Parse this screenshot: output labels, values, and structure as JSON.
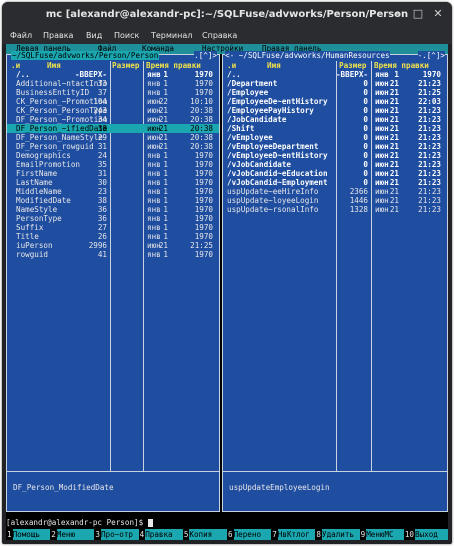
{
  "window": {
    "title": "mc [alexandr@alexandr-pc]:~/SQLFuse/advworks/Person/Person"
  },
  "menubar": [
    "Файл",
    "Правка",
    "Вид",
    "Поиск",
    "Терминал",
    "Справка"
  ],
  "mc_menu": [
    "Левая панель",
    "Файл",
    "Команда",
    "Настройки",
    "Правая панель"
  ],
  "left_panel": {
    "path": "~/SQLFuse/advworks/Person/Person",
    "corner": ".[^]>",
    "headers": {
      "flag": ".и",
      "name": "Имя",
      "size": "Размер",
      "time": "Время правки"
    },
    "rows": [
      {
        "name": "/..",
        "size": "-ВВЕРХ-",
        "mon": "янв",
        "day": "1",
        "time": "1970",
        "type": "dir"
      },
      {
        "name": "Additional~ntactInfo",
        "size": "33",
        "mon": "янв",
        "day": "1",
        "time": "1970",
        "type": "file"
      },
      {
        "name": "BusinessEntityID",
        "size": "37",
        "mon": "янв",
        "day": "1",
        "time": "1970",
        "type": "file"
      },
      {
        "name": "CK_Person_~Promotion",
        "size": "104",
        "mon": "июн",
        "day": "22",
        "time": "10:10",
        "type": "file"
      },
      {
        "name": "CK_Person_PersonType",
        "size": "243",
        "mon": "июн",
        "day": "21",
        "time": "20:38",
        "type": "file"
      },
      {
        "name": "DF_Person_~Promotion",
        "size": "34",
        "mon": "июн",
        "day": "21",
        "time": "20:38",
        "type": "file"
      },
      {
        "name": "DF_Person_~ifiedDate",
        "size": "38",
        "mon": "июн",
        "day": "21",
        "time": "20:38",
        "type": "sel"
      },
      {
        "name": "DF_Person_NameStyle",
        "size": "29",
        "mon": "июн",
        "day": "21",
        "time": "20:38",
        "type": "file"
      },
      {
        "name": "DF_Person_rowguid",
        "size": "31",
        "mon": "июн",
        "day": "21",
        "time": "20:38",
        "type": "file"
      },
      {
        "name": "Demographics",
        "size": "24",
        "mon": "янв",
        "day": "1",
        "time": "1970",
        "type": "file"
      },
      {
        "name": "EmailPromotion",
        "size": "35",
        "mon": "янв",
        "day": "1",
        "time": "1970",
        "type": "file"
      },
      {
        "name": "FirstName",
        "size": "31",
        "mon": "янв",
        "day": "1",
        "time": "1970",
        "type": "file"
      },
      {
        "name": "LastName",
        "size": "30",
        "mon": "янв",
        "day": "1",
        "time": "1970",
        "type": "file"
      },
      {
        "name": "MiddleName",
        "size": "23",
        "mon": "янв",
        "day": "1",
        "time": "1970",
        "type": "file"
      },
      {
        "name": "ModifiedDate",
        "size": "38",
        "mon": "янв",
        "day": "1",
        "time": "1970",
        "type": "file"
      },
      {
        "name": "NameStyle",
        "size": "36",
        "mon": "янв",
        "day": "1",
        "time": "1970",
        "type": "file"
      },
      {
        "name": "PersonType",
        "size": "36",
        "mon": "янв",
        "day": "1",
        "time": "1970",
        "type": "file"
      },
      {
        "name": "Suffix",
        "size": "27",
        "mon": "янв",
        "day": "1",
        "time": "1970",
        "type": "file"
      },
      {
        "name": "Title",
        "size": "26",
        "mon": "янв",
        "day": "1",
        "time": "1970",
        "type": "file"
      },
      {
        "name": "iuPerson",
        "size": "2996",
        "mon": "июн",
        "day": "21",
        "time": "21:25",
        "type": "file"
      },
      {
        "name": "rowguid",
        "size": "41",
        "mon": "янв",
        "day": "1",
        "time": "1970",
        "type": "file"
      }
    ],
    "status": "DF_Person_ModifiedDate"
  },
  "right_panel": {
    "path": "~/SQLFuse/advworks/HumanResources",
    "corner": "-.[^]>",
    "headers": {
      "flag": ".и",
      "name": "Имя",
      "size": "Размер",
      "time": "Время правки"
    },
    "rows": [
      {
        "name": "/..",
        "size": "-ВВЕРХ-",
        "mon": "янв",
        "day": "1",
        "time": "1970",
        "type": "dir"
      },
      {
        "name": "/Department",
        "size": "0",
        "mon": "июн",
        "day": "21",
        "time": "21:23",
        "type": "dir"
      },
      {
        "name": "/Employee",
        "size": "0",
        "mon": "июн",
        "day": "21",
        "time": "21:25",
        "type": "dir"
      },
      {
        "name": "/EmployeeDe~entHistory",
        "size": "0",
        "mon": "июн",
        "day": "21",
        "time": "22:03",
        "type": "dir"
      },
      {
        "name": "/EmployeePayHistory",
        "size": "0",
        "mon": "июн",
        "day": "21",
        "time": "21:23",
        "type": "dir"
      },
      {
        "name": "/JobCandidate",
        "size": "0",
        "mon": "июн",
        "day": "21",
        "time": "21:23",
        "type": "dir"
      },
      {
        "name": "/Shift",
        "size": "0",
        "mon": "июн",
        "day": "21",
        "time": "21:23",
        "type": "dir"
      },
      {
        "name": "/vEmployee",
        "size": "0",
        "mon": "июн",
        "day": "21",
        "time": "21:23",
        "type": "dir"
      },
      {
        "name": "/vEmployeeDepartment",
        "size": "0",
        "mon": "июн",
        "day": "21",
        "time": "21:23",
        "type": "dir"
      },
      {
        "name": "/vEmployeeD~entHistory",
        "size": "0",
        "mon": "июн",
        "day": "21",
        "time": "21:23",
        "type": "dir"
      },
      {
        "name": "/vJobCandidate",
        "size": "0",
        "mon": "июн",
        "day": "21",
        "time": "21:23",
        "type": "dir"
      },
      {
        "name": "/vJobCandid~eEducation",
        "size": "0",
        "mon": "июн",
        "day": "21",
        "time": "21:23",
        "type": "dir"
      },
      {
        "name": "/vJobCandid~Employment",
        "size": "0",
        "mon": "июн",
        "day": "21",
        "time": "21:23",
        "type": "dir"
      },
      {
        "name": "uspUpdate~eeHireInfo",
        "size": "2366",
        "mon": "июн",
        "day": "21",
        "time": "21:23",
        "type": "file"
      },
      {
        "name": "uspUpdate~loyeeLogin",
        "size": "1446",
        "mon": "июн",
        "day": "21",
        "time": "21:23",
        "type": "file"
      },
      {
        "name": "uspUpdate~rsonalInfo",
        "size": "1328",
        "mon": "июн",
        "day": "21",
        "time": "21:23",
        "type": "file"
      }
    ],
    "status": "uspUpdateEmployeeLogin"
  },
  "prompt": {
    "text": "[alexandr@alexandr-pc Person]$"
  },
  "fkeys": [
    {
      "n": "1",
      "label": "Помощь"
    },
    {
      "n": "2",
      "label": "Меню"
    },
    {
      "n": "3",
      "label": "Про~отр"
    },
    {
      "n": "4",
      "label": "Правка"
    },
    {
      "n": "5",
      "label": "Копия"
    },
    {
      "n": "6",
      "label": "Перено"
    },
    {
      "n": "7",
      "label": "НвКтлог"
    },
    {
      "n": "8",
      "label": "Удалить"
    },
    {
      "n": "9",
      "label": "МенюMC"
    },
    {
      "n": "10",
      "label": "Выход"
    }
  ],
  "colors": {
    "panel_bg": "#1f4da0",
    "selection": "#1aa7b0",
    "header": "#f1e34a"
  },
  "icons": {
    "minimize": "minimize-icon",
    "maximize": "maximize-icon",
    "close": "close-icon"
  }
}
